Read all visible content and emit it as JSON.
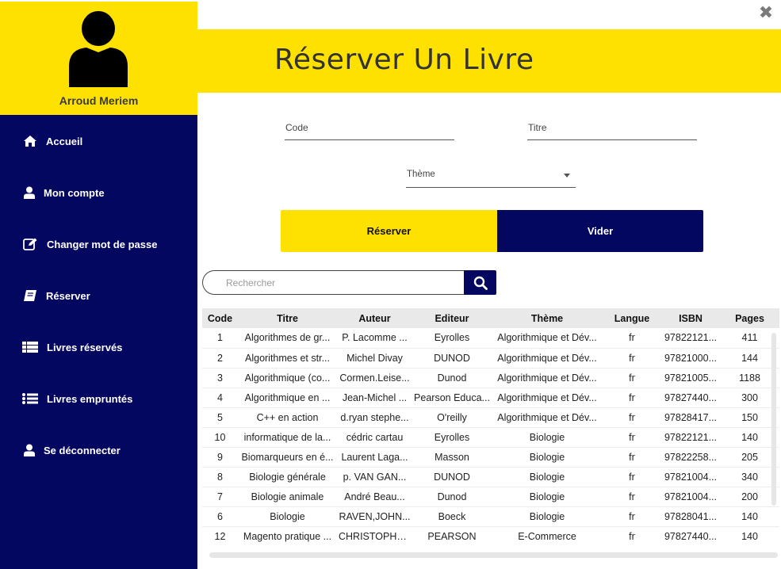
{
  "user": {
    "name": "Arroud Meriem"
  },
  "nav": [
    {
      "id": "accueil",
      "label": "Accueil",
      "icon": "home-icon"
    },
    {
      "id": "compte",
      "label": "Mon compte",
      "icon": "user-icon"
    },
    {
      "id": "password",
      "label": "Changer mot de passe",
      "icon": "edit-icon"
    },
    {
      "id": "reserver",
      "label": "Réserver",
      "icon": "book-icon"
    },
    {
      "id": "reserves",
      "label": "Livres réservés",
      "icon": "list-icon"
    },
    {
      "id": "empruntes",
      "label": "Livres empruntés",
      "icon": "list-ul-icon"
    },
    {
      "id": "logout",
      "label": "Se déconnecter",
      "icon": "user-icon"
    }
  ],
  "header": {
    "title": "Réserver Un Livre",
    "close_glyph": "✖"
  },
  "form": {
    "code_label": "Code",
    "titre_label": "Titre",
    "theme_label": "Thème",
    "reserve_label": "Réserver",
    "clear_label": "Vider"
  },
  "search": {
    "placeholder": "Rechercher"
  },
  "table": {
    "columns": [
      "Code",
      "Titre",
      "Auteur",
      "Editeur",
      "Thème",
      "Langue",
      "ISBN",
      "Pages"
    ],
    "rows": [
      [
        "1",
        "Algorithmes de gr...",
        "P. Lacomme ...",
        "Eyrolles",
        "Algorithmique et Dév...",
        "fr",
        "97822121...",
        "411"
      ],
      [
        "2",
        "Algorithmes et str...",
        "Michel Divay",
        "DUNOD",
        "Algorithmique et Dév...",
        "fr",
        "97821000...",
        "144"
      ],
      [
        "3",
        "Algorithmique (co...",
        "Cormen.Leise...",
        "Dunod",
        "Algorithmique et Dév...",
        "fr",
        "97821005...",
        "1188"
      ],
      [
        "4",
        "Algorithmique en ...",
        "Jean-Michel ...",
        "Pearson Educa...",
        "Algorithmique et Dév...",
        "fr",
        "97827440...",
        "300"
      ],
      [
        "5",
        "C++ en action",
        "d.ryan stephe...",
        "O'reilly",
        "Algorithmique et Dév...",
        "fr",
        "97828417...",
        "150"
      ],
      [
        "10",
        "informatique de la...",
        "cédric cartau",
        "Eyrolles",
        "Biologie",
        "fr",
        "97822121...",
        "140"
      ],
      [
        "9",
        "Biomarqueurs en é...",
        "Laurent Laga...",
        "Masson",
        "Biologie",
        "fr",
        "97822258...",
        "205"
      ],
      [
        "8",
        "Biologie générale",
        "p. VAN GAN...",
        "DUNOD",
        "Biologie",
        "fr",
        "97821004...",
        "340"
      ],
      [
        "7",
        "Biologie animale",
        "André Beau...",
        "Dunod",
        "Biologie",
        "fr",
        "97821004...",
        "200"
      ],
      [
        "6",
        "Biologie",
        "RAVEN,JOHN...",
        "Boeck",
        "Biologie",
        "fr",
        "97828041...",
        "140"
      ],
      [
        "12",
        "Magento pratique ...",
        "CHRISTOPHE...",
        "PEARSON",
        "E-Commerce",
        "fr",
        "97827440...",
        "140"
      ]
    ]
  }
}
